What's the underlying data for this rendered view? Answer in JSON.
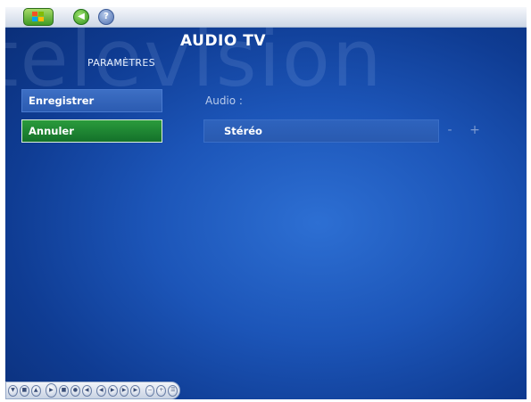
{
  "header": {
    "watermark": "television",
    "title": "AUDIO TV",
    "section": "PARAMÈTRES"
  },
  "toolbar": {
    "start_icon": "windows-logo-icon",
    "back_icon": "back-arrow-icon",
    "help_icon": "help-icon"
  },
  "menu": {
    "items": [
      {
        "label": "Enregistrer"
      },
      {
        "label": "Annuler"
      }
    ]
  },
  "setting": {
    "label": "Audio :",
    "value": "Stéréo",
    "decrease": "-",
    "increase": "+"
  },
  "colors": {
    "background": "#1c55b8",
    "selected": "#14712a",
    "menu_item": "#2b5bb1"
  }
}
